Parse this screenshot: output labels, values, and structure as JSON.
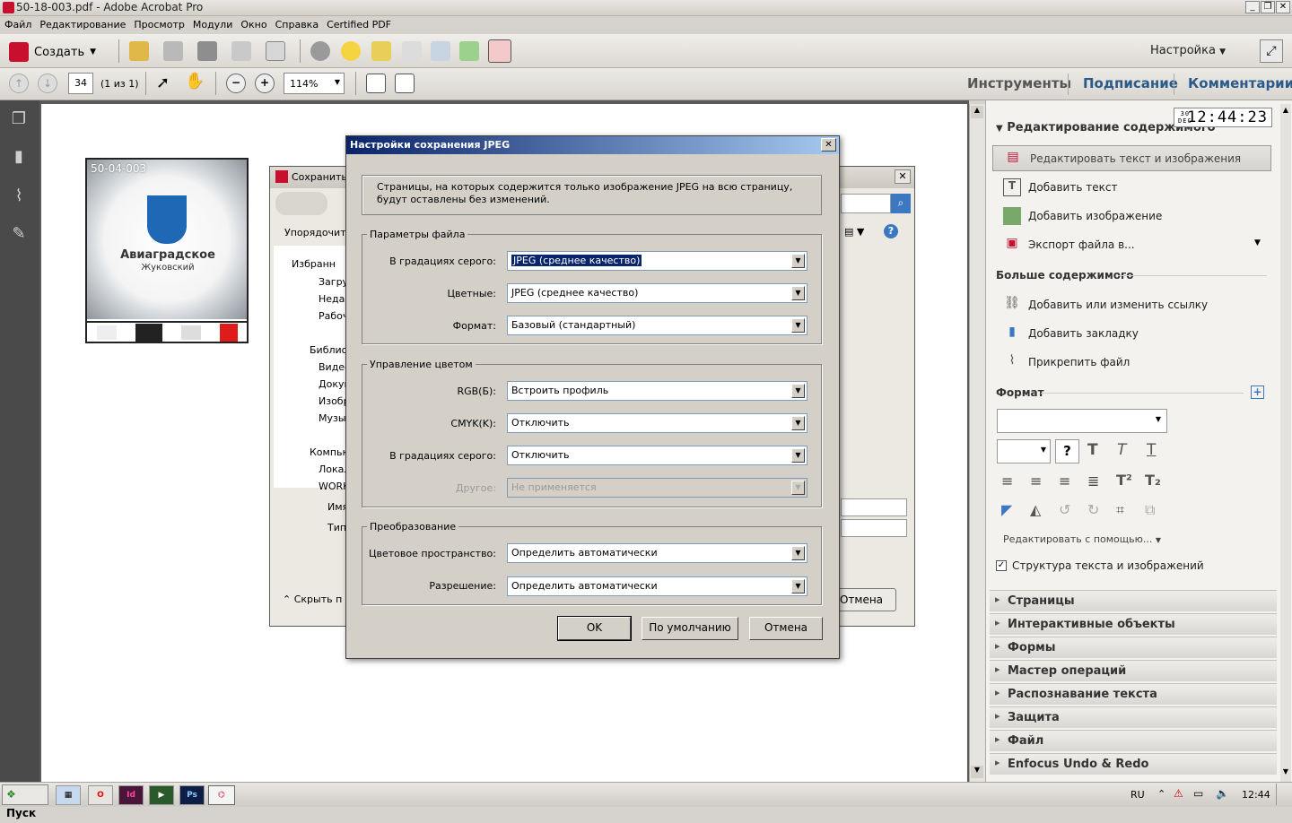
{
  "window": {
    "title": "50-18-003.pdf - Adobe Acrobat Pro"
  },
  "menu": [
    "Файл",
    "Редактирование",
    "Просмотр",
    "Модули",
    "Окно",
    "Справка",
    "Certified PDF"
  ],
  "toolbar": {
    "create_label": "Создать",
    "customize_label": "Настройка"
  },
  "nav": {
    "page_number": "34",
    "page_count": "(1 из 1)",
    "zoom": "114%"
  },
  "panel_tabs": {
    "tools": "Инструменты",
    "sign": "Подписание",
    "comment": "Комментарии"
  },
  "thumbnail": {
    "id_text": "50-04-003",
    "brand": "Авиаградское",
    "sub": "Жуковский"
  },
  "save_window": {
    "title": "Сохранить",
    "organize": "Упорядочить",
    "favorites": "Избранн",
    "downloads": "Загру",
    "recent": "Недав",
    "desktop": "Рабоч",
    "libraries": "Библиот",
    "video": "Видео",
    "docs": "Докум",
    "images": "Изобр",
    "music": "Музы",
    "computer": "Компью",
    "local": "Локал",
    "work": "WORK",
    "name_label": "Имя",
    "type_label": "Тип",
    "hide_label": "Скрыть п",
    "cancel": "Отмена"
  },
  "dialog": {
    "title": "Настройки сохранения JPEG",
    "info": "Страницы, на которых содержится только изображение JPEG на всю страницу, будут оставлены без изменений.",
    "file_group": "Параметры файла",
    "grayscale_label": "В градациях серого:",
    "grayscale_value": "JPEG (среднее качество)",
    "color_label": "Цветные:",
    "color_value": "JPEG (среднее качество)",
    "format_label": "Формат:",
    "format_value": "Базовый (стандартный)",
    "color_group": "Управление цветом",
    "rgb_label": "RGB(Б):",
    "rgb_value": "Встроить профиль",
    "cmyk_label": "CMYK(K):",
    "cmyk_value": "Отключить",
    "gray2_label": "В градациях серого:",
    "gray2_value": "Отключить",
    "other_label": "Другое:",
    "other_value": "Не применяется",
    "conv_group": "Преобразование",
    "space_label": "Цветовое пространство:",
    "space_value": "Определить автоматически",
    "res_label": "Разрешение:",
    "res_value": "Определить автоматически",
    "ok": "OK",
    "defaults": "По умолчанию",
    "cancel": "Отмена"
  },
  "right_panel": {
    "section_title": "Редактирование содержимого",
    "edit_text": "Редактировать текст и изображения",
    "add_text": "Добавить текст",
    "add_image": "Добавить изображение",
    "export": "Экспорт файла в...",
    "more_title": "Больше содержимого",
    "add_link": "Добавить или изменить ссылку",
    "add_bookmark": "Добавить закладку",
    "attach": "Прикрепить файл",
    "format_title": "Формат",
    "edit_with": "Редактировать с помощью...",
    "structure": "Структура текста и изображений",
    "accordions": [
      "Страницы",
      "Интерактивные объекты",
      "Формы",
      "Мастер операций",
      "Распознавание текста",
      "Защита",
      "Файл",
      "Enfocus Undo & Redo"
    ]
  },
  "clock": {
    "day": "30",
    "month": "DEC",
    "time": "12:44:23"
  },
  "taskbar": {
    "start": "Пуск",
    "lang": "RU",
    "time": "12:44"
  }
}
